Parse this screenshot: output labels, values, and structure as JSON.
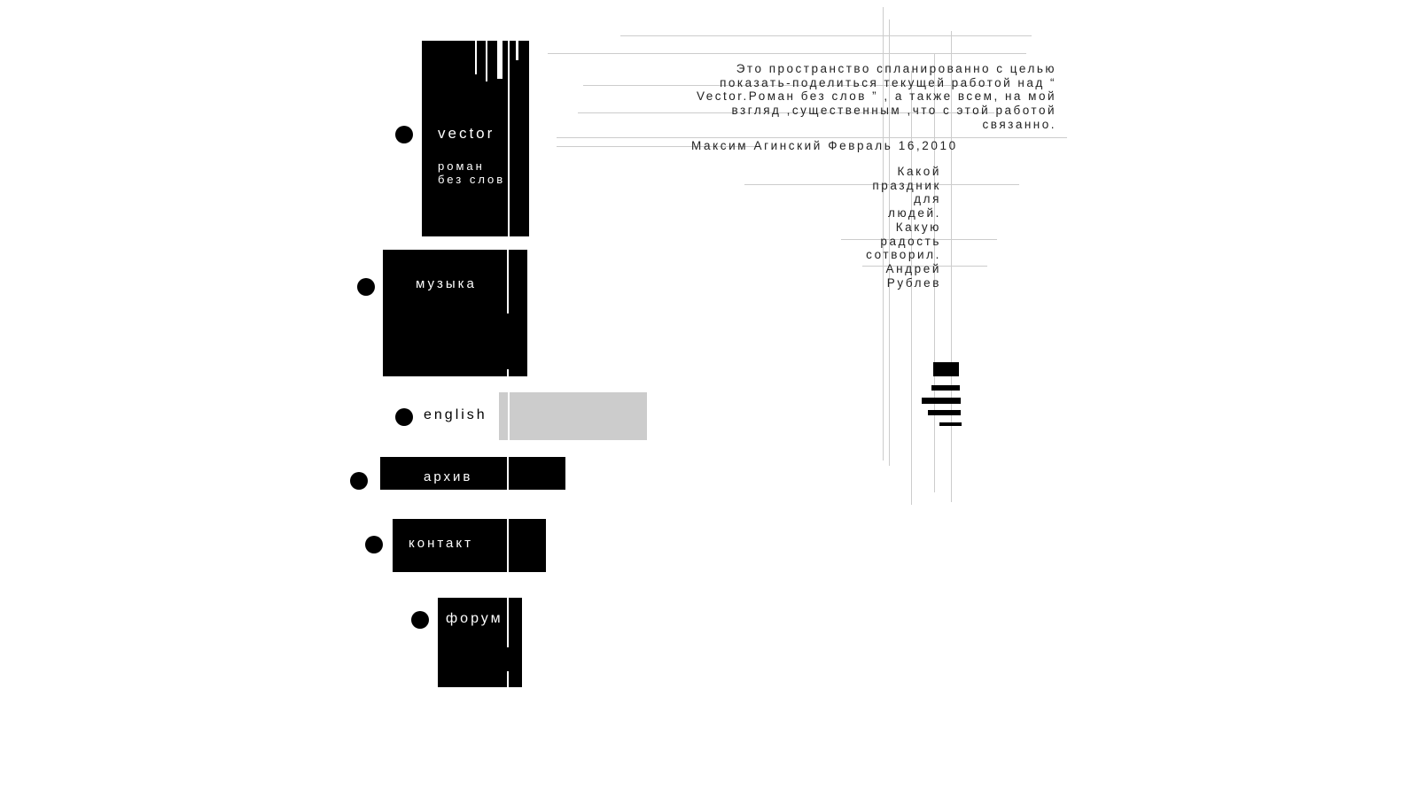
{
  "intro": {
    "lines": [
      "Это  пространство спланированно с целью",
      "показать-поделиться текущей работой  над “",
      "Vector.Роман без слов ”  , а также всем, на мой",
      "взгляд ,существенным ,что с этой работой",
      "связанно."
    ],
    "signature": "Максим Агинский Февраль 16,2010"
  },
  "poem": {
    "lines": [
      "Какой",
      "праздник",
      "для",
      "людей.",
      "Какую",
      "радость",
      "сотворил.",
      "Андрей",
      "Рублев"
    ]
  },
  "nav": {
    "vector": {
      "title": "vector",
      "subtitle_line1": "роман",
      "subtitle_line2": "без слов"
    },
    "music": {
      "label": "музыка"
    },
    "english": {
      "label": "english"
    },
    "archive": {
      "label": "архив"
    },
    "contact": {
      "label": "контакт"
    },
    "forum": {
      "label": "форум"
    }
  },
  "colors": {
    "block": "#000000",
    "english_panel": "#cccccc",
    "grid_line": "#cccccc"
  }
}
